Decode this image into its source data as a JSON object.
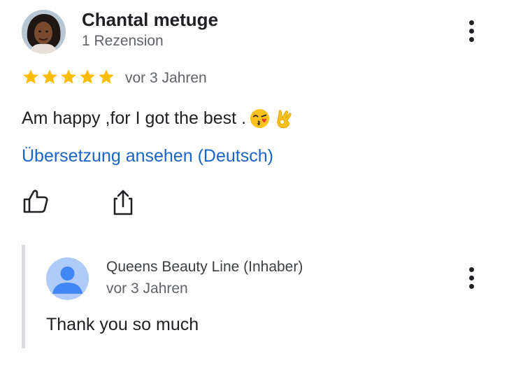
{
  "review": {
    "author": "Chantal metuge",
    "review_count": "1 Rezension",
    "rating": 5,
    "date": "vor 3 Jahren",
    "text": "Am happy ,for I got the best .",
    "emojis": [
      "kissing-face-emoji",
      "ok-hand-emoji"
    ],
    "translate_link": "Übersetzung ansehen (Deutsch)"
  },
  "reply": {
    "owner_name": "Queens Beauty Line (Inhaber)",
    "date": "vor 3 Jahren",
    "text": "Thank you so much"
  },
  "icons": {
    "star": "star-icon",
    "like": "thumbs-up-icon",
    "share": "share-icon",
    "menu": "more-vert-icon"
  },
  "colors": {
    "star": "#fbbc04",
    "link": "#1a64c8",
    "secondary_text": "#5f6368",
    "reply_border": "#dadce0",
    "owner_avatar_bg": "#aecbfa",
    "owner_avatar_fg": "#4285f4"
  }
}
